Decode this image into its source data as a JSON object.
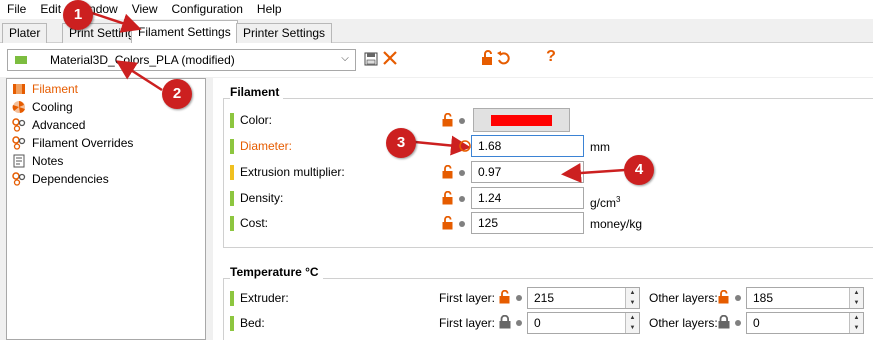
{
  "menubar": {
    "items": [
      "File",
      "Edit",
      "Window",
      "View",
      "Configuration",
      "Help"
    ]
  },
  "tabs": [
    {
      "label": "Plater"
    },
    {
      "label": "Print Settings"
    },
    {
      "label": "Filament Settings"
    },
    {
      "label": "Printer Settings"
    }
  ],
  "preset": {
    "name": "Material3D_Colors_PLA (modified)",
    "swatch_color": "#7cbd3f"
  },
  "sidebar": {
    "items": [
      {
        "label": "Filament",
        "icon": "filament-icon",
        "active": true
      },
      {
        "label": "Cooling",
        "icon": "fan-icon"
      },
      {
        "label": "Advanced",
        "icon": "cog-icon"
      },
      {
        "label": "Filament Overrides",
        "icon": "cog-icon"
      },
      {
        "label": "Notes",
        "icon": "notes-icon"
      },
      {
        "label": "Dependencies",
        "icon": "cog-icon"
      }
    ]
  },
  "filament_group": {
    "title": "Filament",
    "color": {
      "label": "Color:",
      "value_color": "#ff0000"
    },
    "diameter": {
      "label": "Diameter:",
      "value": "1.68",
      "unit": "mm"
    },
    "extrusion": {
      "label": "Extrusion multiplier:",
      "value": "0.97"
    },
    "density": {
      "label": "Density:",
      "value": "1.24",
      "unit": "g/cm",
      "unit_sup": "3"
    },
    "cost": {
      "label": "Cost:",
      "value": "125",
      "unit": "money/kg"
    }
  },
  "temperature_group": {
    "title": "Temperature °C",
    "extruder": {
      "label": "Extruder:",
      "first_label": "First layer:",
      "first_value": "215",
      "other_label": "Other layers:",
      "other_value": "185"
    },
    "bed": {
      "label": "Bed:",
      "first_label": "First layer:",
      "first_value": "0",
      "other_label": "Other layers:",
      "other_value": "0"
    }
  },
  "callouts": [
    "1",
    "2",
    "3",
    "4"
  ],
  "colors": {
    "accent_orange": "#e65c00",
    "flag_green": "#8dc63f",
    "flag_yellow": "#f0c020",
    "callout_red": "#cc2020"
  }
}
